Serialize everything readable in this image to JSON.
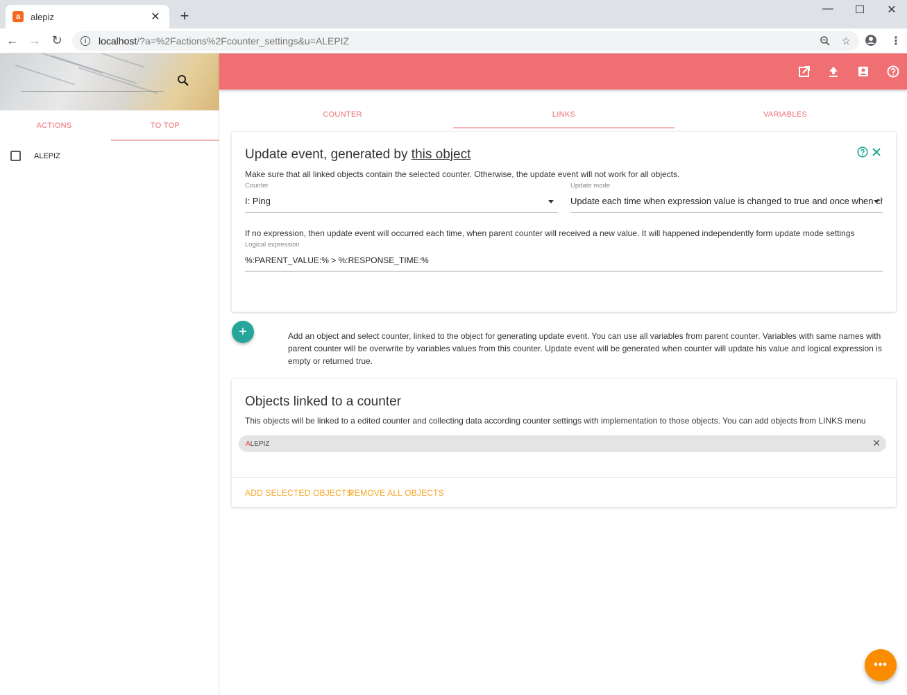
{
  "browser": {
    "tab_title": "alepiz",
    "favicon_letter": "a",
    "new_tab": "+",
    "url_host": "localhost",
    "url_path": "/?a=%2Factions%2Fcounter_settings&u=ALEPIZ"
  },
  "left": {
    "tabs": [
      "ACTIONS",
      "TO TOP"
    ],
    "objects": [
      {
        "label": "ALEPIZ",
        "checked": false
      }
    ]
  },
  "main": {
    "tabs": [
      "COUNTER",
      "LINKS",
      "VARIABLES"
    ],
    "active_tab": "LINKS"
  },
  "update_event": {
    "title_prefix": "Update event, generated by ",
    "title_link": "this object",
    "description": "Make sure that all linked objects contain the selected counter. Otherwise, the update event will not work for all objects.",
    "counter_label": "Counter",
    "counter_value": "I: Ping",
    "mode_label": "Update mode",
    "mode_value": "Update each time when expression value is changed to true and once when changed to false",
    "expr_hint": "If no expression, then update event will occurred each time, when parent counter will received a new value. It will happened independently form update mode settings",
    "expr_label": "Logical expression",
    "expr_value": "%:PARENT_VALUE:% > %:RESPONSE_TIME:%"
  },
  "hint_text": "Add an object and select counter, linked to the object for generating update event. You can use all variables from parent counter. Variables with same names with parent counter will be overwrite by variables values from this counter. Update event will be generated when counter will update his value and logical expression is empty or returned true.",
  "linked": {
    "title": "Objects linked to a counter",
    "description": "This objects will be linked to a edited counter and collecting data according counter settings with implementation to those objects. You can add objects from LINKS menu",
    "chip_first": "A",
    "chip_rest": "LEPIZ",
    "add_label": "ADD SELECTED OBJECTS",
    "remove_label": "REMOVE ALL OBJECTS"
  },
  "colors": {
    "accent": "#ef6f73",
    "teal": "#26a69a",
    "orange": "#fb8c00",
    "link": "#f5a623"
  },
  "icons": [
    "search-icon",
    "open-in-new-icon",
    "upload-icon",
    "account-box-icon",
    "help-icon",
    "close-icon",
    "add-icon",
    "more-icon"
  ]
}
